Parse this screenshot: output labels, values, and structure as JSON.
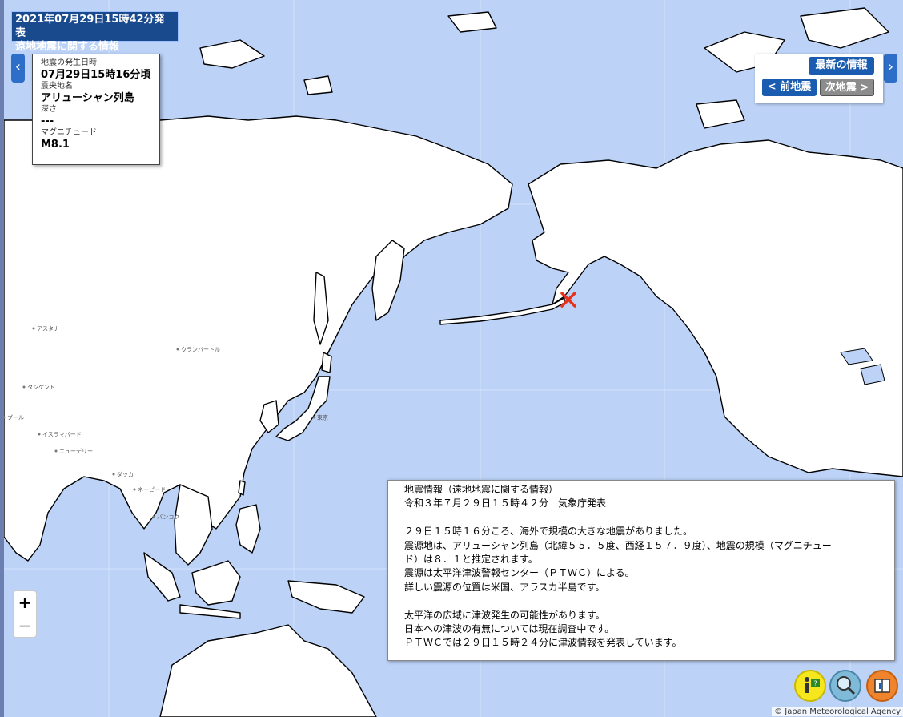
{
  "header": {
    "line1": "2021年07月29日15時42分発表",
    "line2": "遠地地震に関する情報"
  },
  "info_panel": {
    "time_label": "地震の発生日時",
    "time_value": "07月29日15時16分頃",
    "region_label": "震央地名",
    "region_value": "アリューシャン列島",
    "depth_label": "深さ",
    "depth_value": "---",
    "magnitude_label": "マグニチュード",
    "magnitude_value": "M8.1"
  },
  "nav": {
    "latest_label": "最新の情報",
    "prev_label": "< 前地震",
    "next_label": "次地震 >"
  },
  "zoom": {
    "in_label": "+",
    "out_label": "−"
  },
  "bulletin": {
    "lines": [
      "地震情報（遠地地震に関する情報）",
      "令和３年７月２９日１５時４２分　気象庁発表",
      "",
      "２９日１５時１６分ころ、海外で規模の大きな地震がありました。",
      "震源地は、アリューシャン列島（北緯５５．５度、西経１５７．９度）、地震の規模（マグニチュー",
      "ド）は８．１と推定されます。",
      "震源は太平洋津波警報センター（ＰＴＷＣ）による。",
      "詳しい震源の位置は米国、アラスカ半島です。",
      "",
      "太平洋の広域に津波発生の可能性があります。",
      "日本への津波の有無については現在調査中です。",
      "ＰＴＷＣでは２９日１５時２４分に津波情報を発表しています。"
    ]
  },
  "cities": [
    {
      "name": "アスタナ"
    },
    {
      "name": "ウランバートル"
    },
    {
      "name": "タシケント"
    },
    {
      "name": "ブール"
    },
    {
      "name": "イスラマバード"
    },
    {
      "name": "ニューデリー"
    },
    {
      "name": "ダッカ"
    },
    {
      "name": "ネーピードー"
    },
    {
      "name": "バンコク"
    },
    {
      "name": "東京"
    }
  ],
  "epicenter": {
    "lat": 55.5,
    "lon": -157.9
  },
  "credit": "© Japan Meteorological Agency",
  "colors": {
    "ocean": "#bcd2f7",
    "land": "#ffffff",
    "header_bg": "#1a4a8e",
    "button_blue": "#1a5cb0",
    "button_gray": "#8c8c8c",
    "epicenter": "#e8321e"
  },
  "icons": [
    "info-person-icon",
    "more-search-icon",
    "book-icon"
  ]
}
